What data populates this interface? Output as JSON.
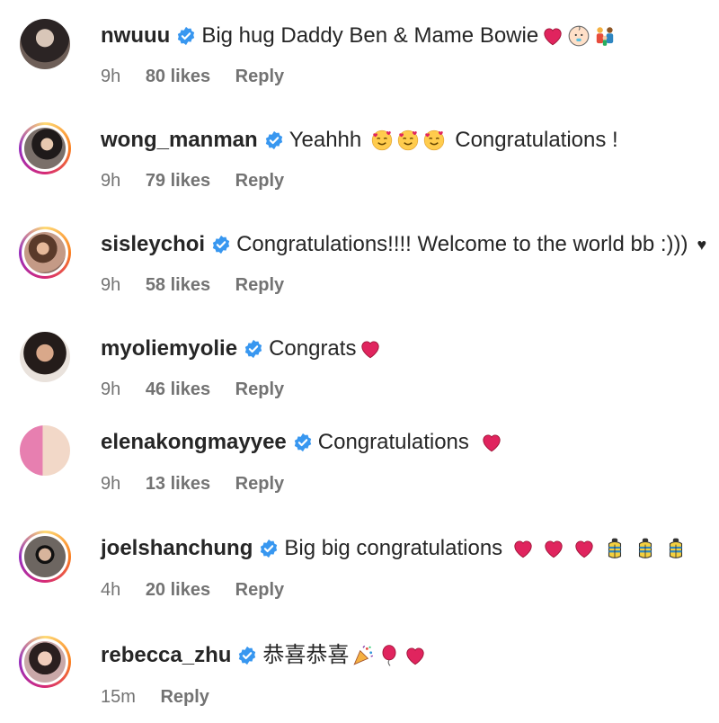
{
  "comments": [
    {
      "username": "nwuuu",
      "text": "Big hug Daddy Ben & Mame Bowie",
      "time": "9h",
      "likes": "80 likes",
      "reply": "Reply",
      "emojis": [
        "red-heart",
        "baby",
        "family"
      ]
    },
    {
      "username": "wong_manman",
      "text": "Yeahhh",
      "text2": "Congratulations !",
      "time": "9h",
      "likes": "79 likes",
      "reply": "Reply",
      "emojis": [
        "smiling-hearts",
        "smiling-hearts",
        "smiling-hearts"
      ]
    },
    {
      "username": "sisleychoi",
      "text": "Congratulations!!!! Welcome to the world bb :)))",
      "time": "9h",
      "likes": "58 likes",
      "reply": "Reply",
      "emojis": [
        "black-heart"
      ]
    },
    {
      "username": "myoliemyolie",
      "text": "Congrats",
      "time": "9h",
      "likes": "46 likes",
      "reply": "Reply",
      "emojis": [
        "red-heart"
      ]
    },
    {
      "username": "elenakongmayyee",
      "text": "Congratulations",
      "time": "9h",
      "likes": "13 likes",
      "reply": "Reply",
      "emojis": [
        "red-heart"
      ]
    },
    {
      "username": "joelshanchung",
      "text": "Big big congratulations",
      "time": "4h",
      "likes": "20 likes",
      "reply": "Reply",
      "emojis": [
        "red-heart",
        "red-heart",
        "red-heart",
        "baby-bottle",
        "baby-bottle",
        "baby-bottle"
      ]
    },
    {
      "username": "rebecca_zhu",
      "text": "恭喜恭喜",
      "time": "15m",
      "likes": "",
      "reply": "Reply",
      "emojis": [
        "party-popper",
        "balloon",
        "red-heart"
      ]
    }
  ],
  "colors": {
    "verified": "#3897f0",
    "heart": "#e0245e",
    "muted": "#737373",
    "text": "#262626"
  }
}
